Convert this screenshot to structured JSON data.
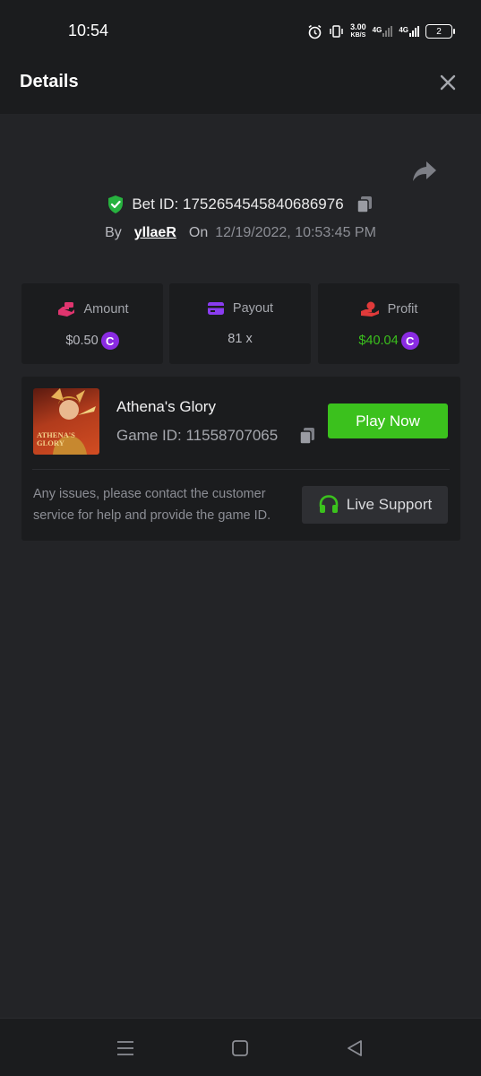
{
  "status_bar": {
    "time": "10:54",
    "net_speed_value": "3.00",
    "net_speed_unit": "KB/S",
    "network_1": "4G",
    "network_2": "4G",
    "battery_level": "2"
  },
  "header": {
    "title": "Details"
  },
  "bet": {
    "id_label": "Bet ID: 1752654545840686976",
    "by_label": "By",
    "username": "yllaeR",
    "on_label": "On",
    "datetime": "12/19/2022, 10:53:45 PM"
  },
  "stats": {
    "amount_label": "Amount",
    "amount_value": "$0.50",
    "payout_label": "Payout",
    "payout_value": "81 x",
    "profit_label": "Profit",
    "profit_value": "$40.04",
    "coin_symbol": "C"
  },
  "game": {
    "thumbnail_text_1": "ATHENA'S",
    "thumbnail_text_2": "GLORY",
    "name": "Athena's Glory",
    "id_label": "Game ID: 11558707065",
    "play_label": "Play Now",
    "support_text": "Any issues, please contact the customer service for help and provide the game ID.",
    "support_label": "Live Support"
  },
  "colors": {
    "background": "#232427",
    "panel": "#1b1c1e",
    "accent_green": "#3bc11d",
    "profit_green": "#3bc11d",
    "coin_purple": "#8a2be2",
    "amount_icon": "#e0356f",
    "payout_icon": "#8a3cf0",
    "profit_icon": "#e03a3a"
  },
  "icons": {
    "shield": "shield-check-icon",
    "copy": "copy-icon",
    "share": "share-icon",
    "close": "close-icon",
    "headset": "headset-icon"
  }
}
